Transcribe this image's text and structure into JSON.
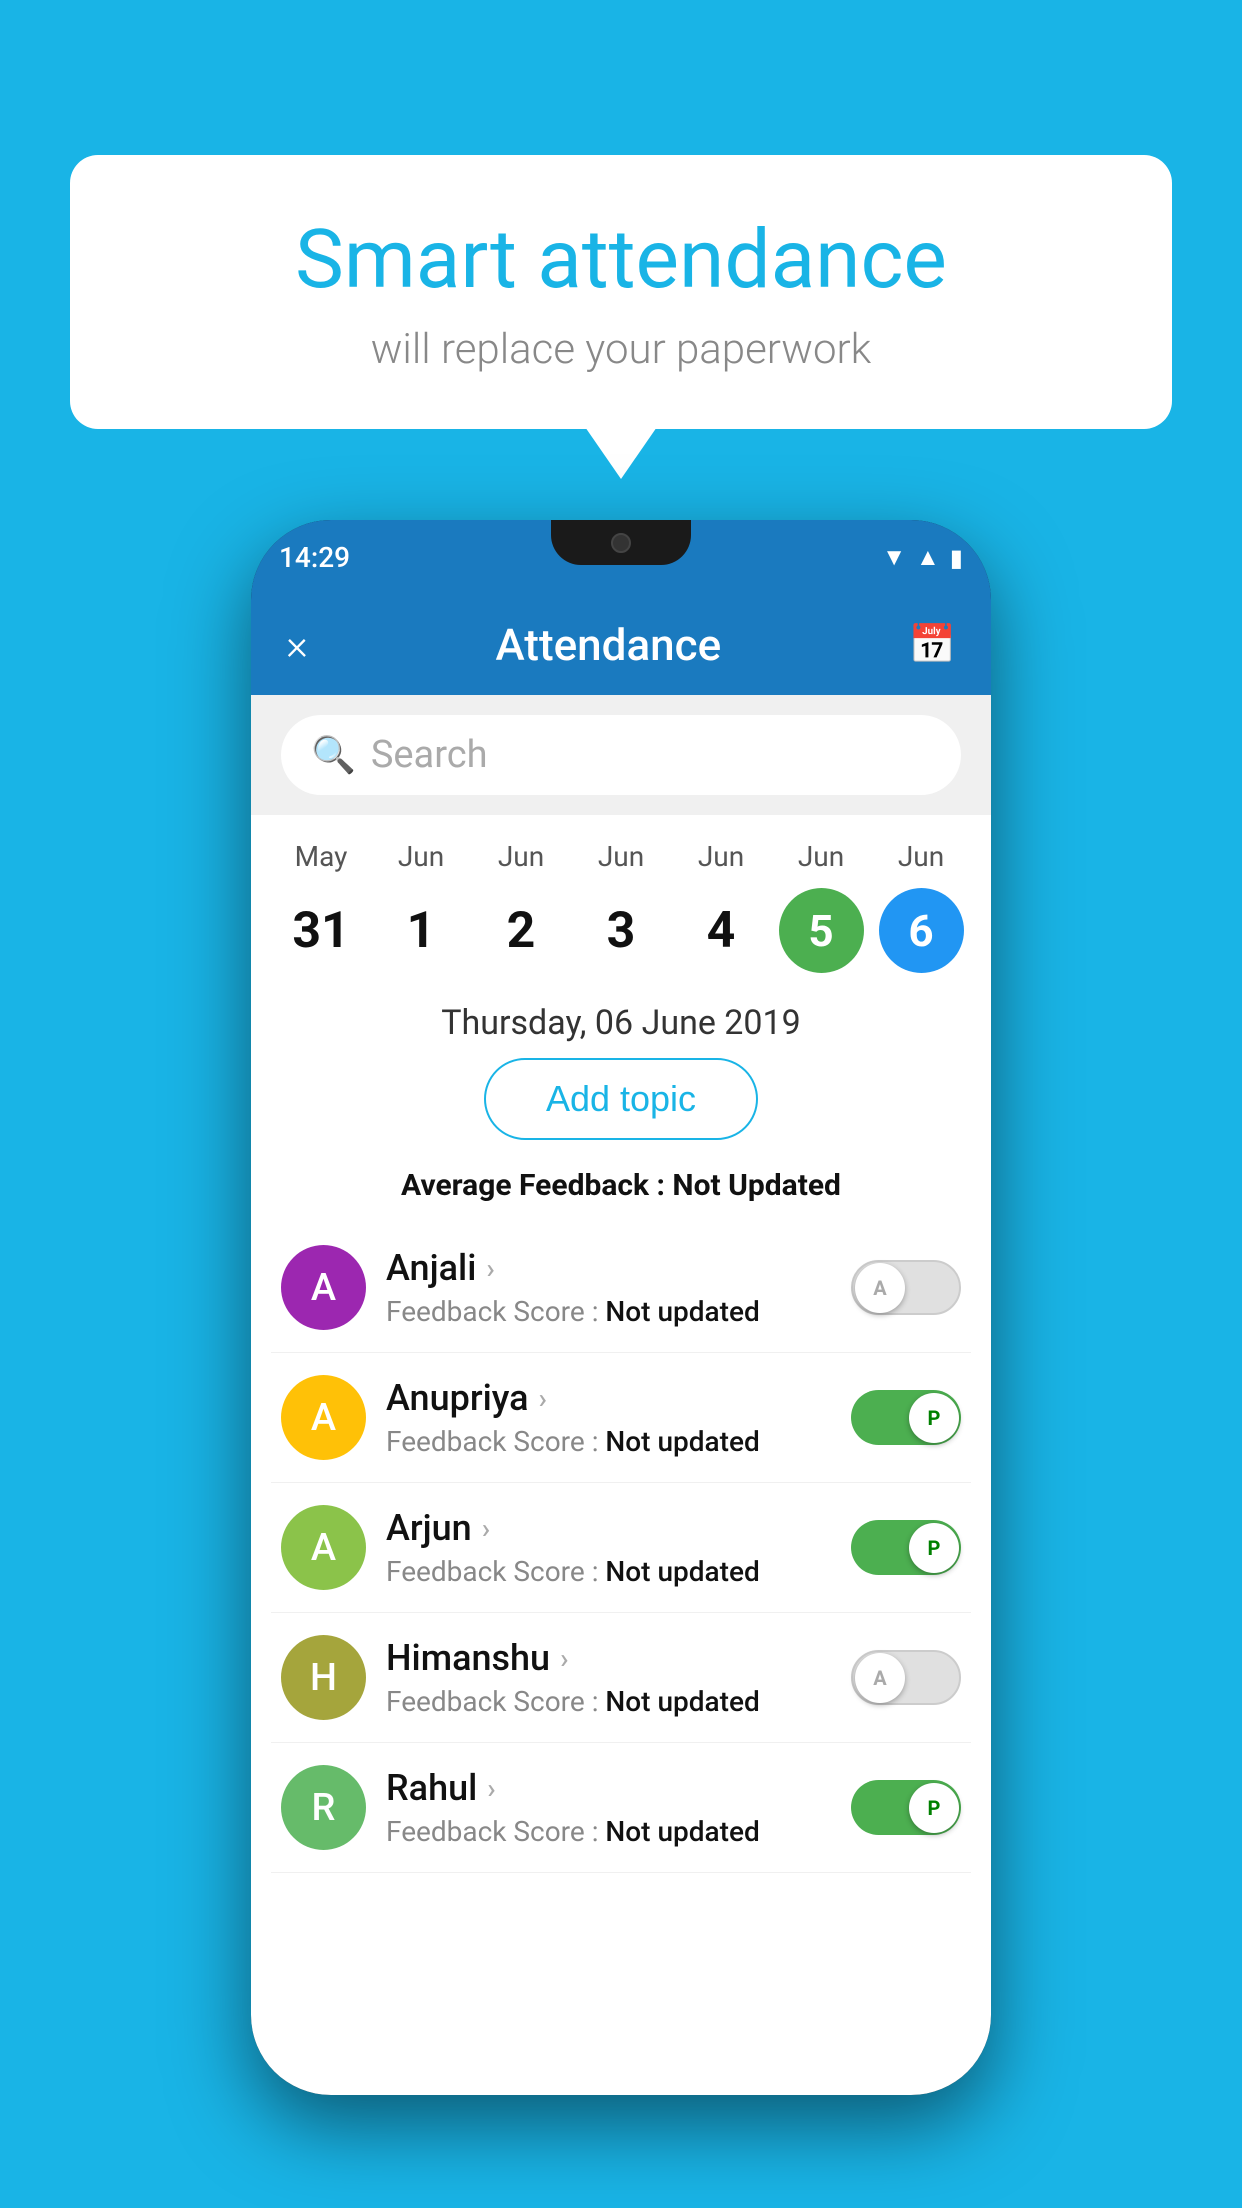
{
  "background_color": "#19b4e6",
  "bubble": {
    "title": "Smart attendance",
    "subtitle": "will replace your paperwork"
  },
  "phone": {
    "status_bar": {
      "time": "14:29",
      "icons": [
        "wifi",
        "signal",
        "battery"
      ]
    },
    "header": {
      "close_label": "×",
      "title": "Attendance",
      "calendar_icon": "📅"
    },
    "search": {
      "placeholder": "Search"
    },
    "dates": [
      {
        "month": "May",
        "day": "31",
        "selected": false
      },
      {
        "month": "Jun",
        "day": "1",
        "selected": false
      },
      {
        "month": "Jun",
        "day": "2",
        "selected": false
      },
      {
        "month": "Jun",
        "day": "3",
        "selected": false
      },
      {
        "month": "Jun",
        "day": "4",
        "selected": false
      },
      {
        "month": "Jun",
        "day": "5",
        "selected": "green"
      },
      {
        "month": "Jun",
        "day": "6",
        "selected": "blue"
      }
    ],
    "selected_date": "Thursday, 06 June 2019",
    "add_topic_label": "Add topic",
    "avg_feedback_label": "Average Feedback :",
    "avg_feedback_value": "Not Updated",
    "students": [
      {
        "name": "Anjali",
        "initials": "A",
        "avatar_color": "purple",
        "feedback_label": "Feedback Score :",
        "feedback_value": "Not updated",
        "toggle": "off",
        "toggle_letter": "A"
      },
      {
        "name": "Anupriya",
        "initials": "A",
        "avatar_color": "yellow",
        "feedback_label": "Feedback Score :",
        "feedback_value": "Not updated",
        "toggle": "on",
        "toggle_letter": "P"
      },
      {
        "name": "Arjun",
        "initials": "A",
        "avatar_color": "lightgreen",
        "feedback_label": "Feedback Score :",
        "feedback_value": "Not updated",
        "toggle": "on",
        "toggle_letter": "P"
      },
      {
        "name": "Himanshu",
        "initials": "H",
        "avatar_color": "khaki",
        "feedback_label": "Feedback Score :",
        "feedback_value": "Not updated",
        "toggle": "off",
        "toggle_letter": "A"
      },
      {
        "name": "Rahul",
        "initials": "R",
        "avatar_color": "green2",
        "feedback_label": "Feedback Score :",
        "feedback_value": "Not updated",
        "toggle": "on",
        "toggle_letter": "P"
      }
    ]
  }
}
